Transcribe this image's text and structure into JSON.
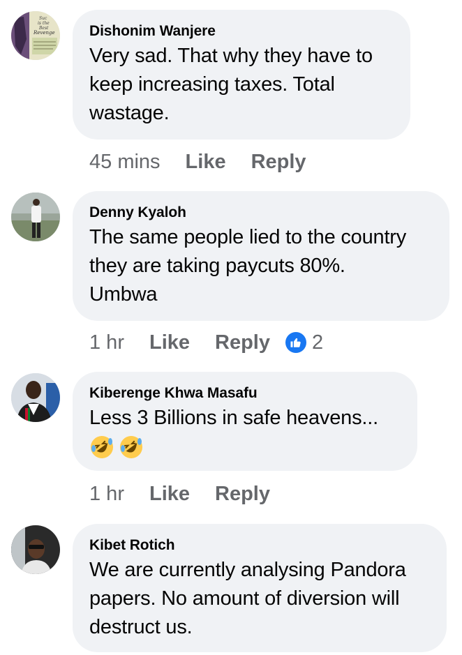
{
  "comments": [
    {
      "author": "Dishonim Wanjere",
      "text": "Very sad. That why they have to keep increasing taxes. Total wastage.",
      "lines": [
        "Very sad. That why they have to",
        "keep increasing taxes. Total",
        "wastage."
      ],
      "time": "45 mins",
      "like_label": "Like",
      "reply_label": "Reply",
      "avatar_text": [
        "Suc",
        "is the",
        "Best",
        "Revenge"
      ]
    },
    {
      "author": "Denny Kyaloh",
      "lines": [
        "The same people lied to the country",
        "they are taking paycuts 80%.",
        "Umbwa"
      ],
      "time": "1 hr",
      "like_label": "Like",
      "reply_label": "Reply",
      "reaction_count": "2",
      "reaction_icon": "like-reaction-icon"
    },
    {
      "author": "Kiberenge Khwa Masafu",
      "lines": [
        "Less 3 Billions in safe heavens..."
      ],
      "emojis": [
        "rolling-on-floor-laughing-emoji",
        "rolling-on-floor-laughing-emoji"
      ],
      "time": "1 hr",
      "like_label": "Like",
      "reply_label": "Reply"
    },
    {
      "author": "Kibet Rotich",
      "lines": [
        "We are currently analysing Pandora",
        "papers. No amount of diversion will",
        "destruct us."
      ]
    }
  ],
  "colors": {
    "bubble": "#f0f2f5",
    "meta_text": "#65676b",
    "reaction_blue": "#1877f2"
  }
}
